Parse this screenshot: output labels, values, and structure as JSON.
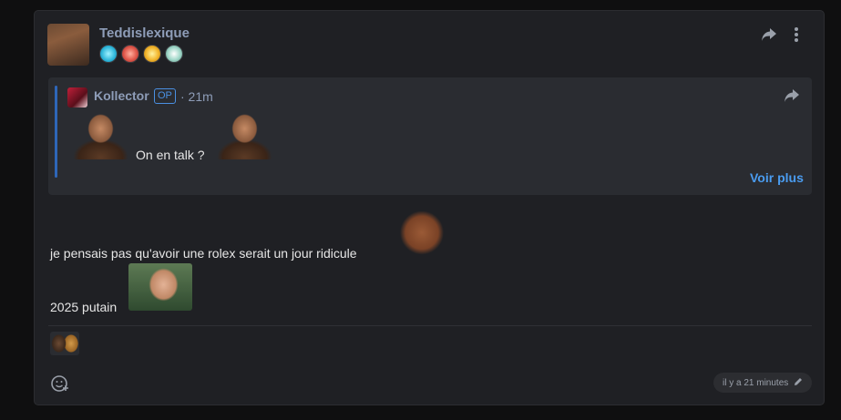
{
  "post": {
    "username": "Teddislexique",
    "badges": [
      "star-badge",
      "dice-badge",
      "laughing-face-badge",
      "soccer-ball-badge"
    ],
    "quote": {
      "username": "Kollector",
      "op_label": "OP",
      "time": "· 21m",
      "text": "On en talk ?",
      "see_more": "Voir plus"
    },
    "lines": [
      "je pensais pas qu'avoir une rolex serait un jour ridicule",
      "2025 putain"
    ],
    "timestamp": "il y a 21 minutes"
  },
  "colors": {
    "background": "#0f0f10",
    "card": "#1f2024",
    "quote": "#2a2c31",
    "accent": "#4a9cf0",
    "username": "#8e9db8"
  }
}
